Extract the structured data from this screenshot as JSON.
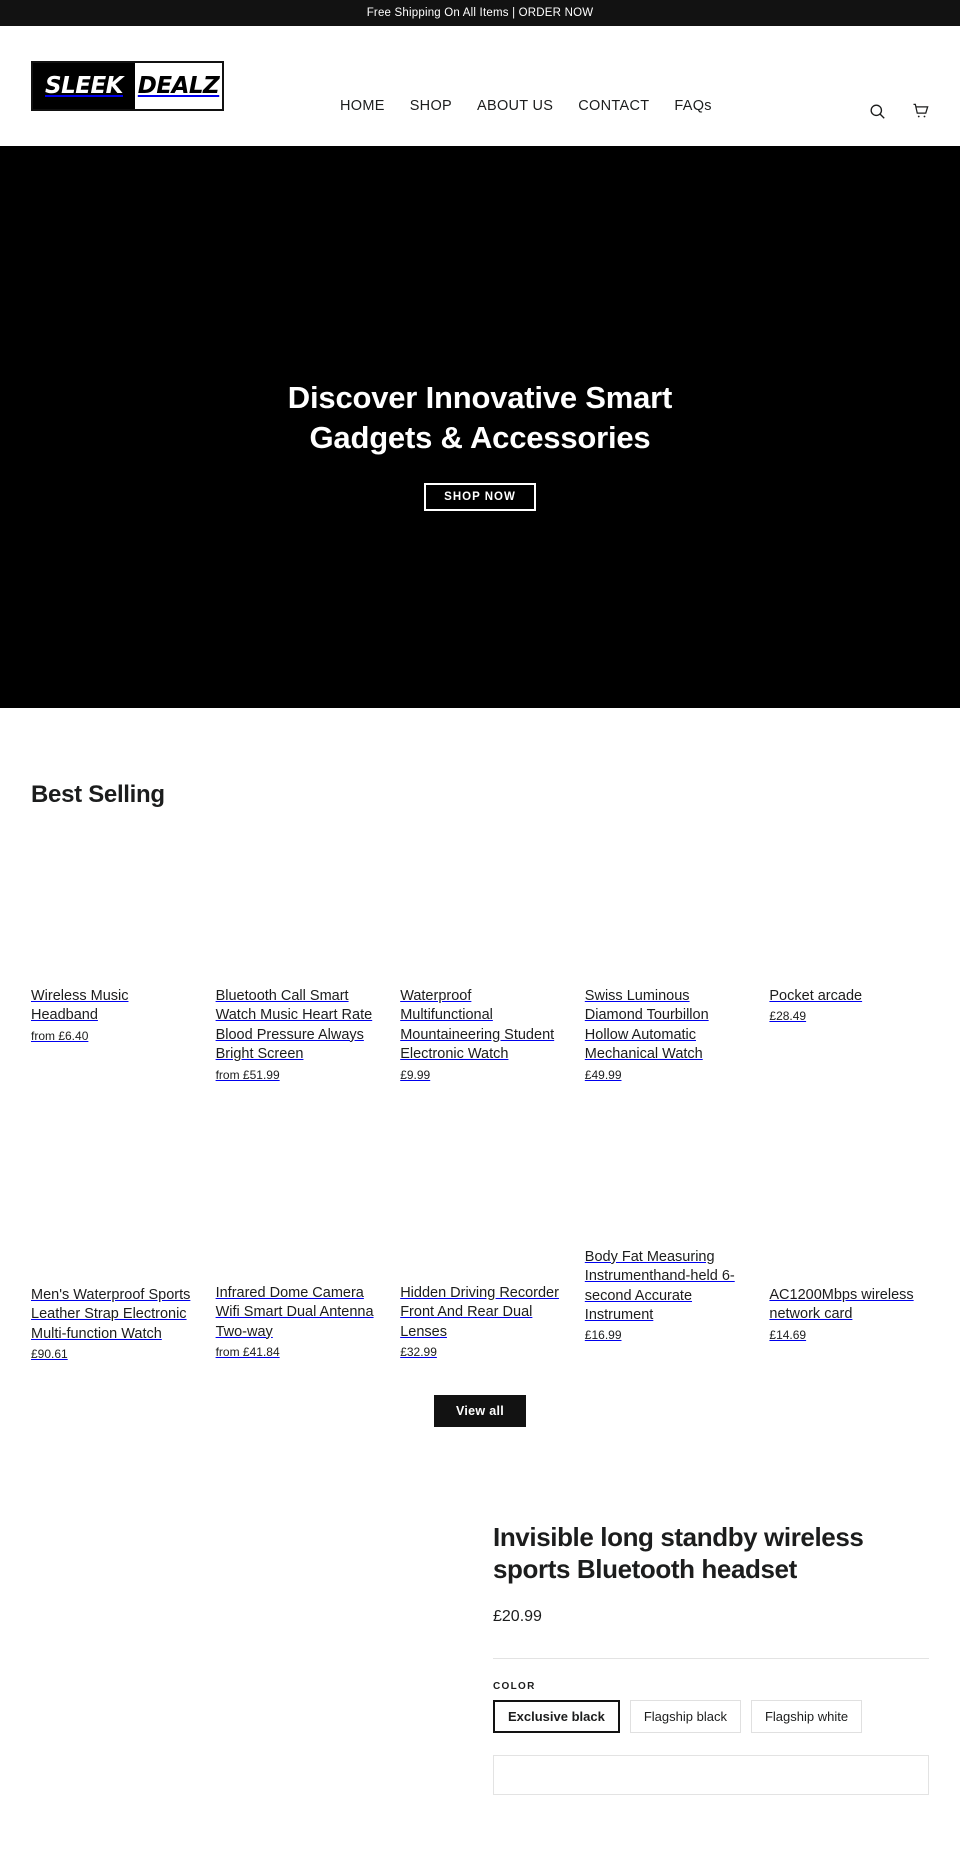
{
  "announcement": {
    "text": "Free Shipping On All Items | ORDER NOW"
  },
  "header": {
    "logo": {
      "left_text": "SLEEK",
      "right_text": "DEALZ",
      "alt": "Sleek Dealz"
    },
    "nav": [
      {
        "label": "HOME"
      },
      {
        "label": "SHOP"
      },
      {
        "label": "ABOUT US"
      },
      {
        "label": "CONTACT"
      },
      {
        "label": "FAQs"
      }
    ],
    "icons": {
      "search": "search-icon",
      "cart": "cart-icon"
    }
  },
  "hero": {
    "heading": "Discover Innovative Smart Gadgets & Accessories",
    "button_label": "SHOP NOW",
    "background_color": "#000000"
  },
  "best_selling": {
    "title": "Best Selling",
    "view_all_label": "View all",
    "row1": [
      {
        "title": "Wireless Music Headband",
        "price": "from £6.40"
      },
      {
        "title": "Bluetooth Call Smart Watch Music Heart Rate Blood Pressure Always Bright Screen",
        "price": "from £51.99"
      },
      {
        "title": "Waterproof Multifunctional Mountaineering Student Electronic Watch",
        "price": "£9.99"
      },
      {
        "title": "Swiss Luminous Diamond Tourbillon Hollow Automatic Mechanical Watch",
        "price": "£49.99"
      },
      {
        "title": "Pocket arcade",
        "price": "£28.49"
      }
    ],
    "row2": [
      {
        "title": "Men's Waterproof Sports Leather Strap Electronic Multi-function Watch",
        "price": "£90.61"
      },
      {
        "title": "Infrared Dome Camera Wifi Smart Dual Antenna Two-way",
        "price": "from £41.84"
      },
      {
        "title": "Hidden Driving Recorder Front And Rear Dual Lenses",
        "price": "£32.99"
      },
      {
        "title": "Body Fat Measuring Instrumenthand-held 6-second Accurate Instrument",
        "price": "£16.99"
      },
      {
        "title": "AC1200Mbps wireless network card",
        "price": "£14.69"
      }
    ]
  },
  "featured_product": {
    "title": "Invisible long standby wireless sports Bluetooth headset",
    "price": "£20.99",
    "option_label": "COLOR",
    "options": [
      {
        "label": "Exclusive black",
        "selected": true
      },
      {
        "label": "Flagship black",
        "selected": false
      },
      {
        "label": "Flagship white",
        "selected": false
      }
    ]
  },
  "colors": {
    "accent": "#121212",
    "text": "#1c1d1d",
    "border": "#e3e3e3"
  }
}
